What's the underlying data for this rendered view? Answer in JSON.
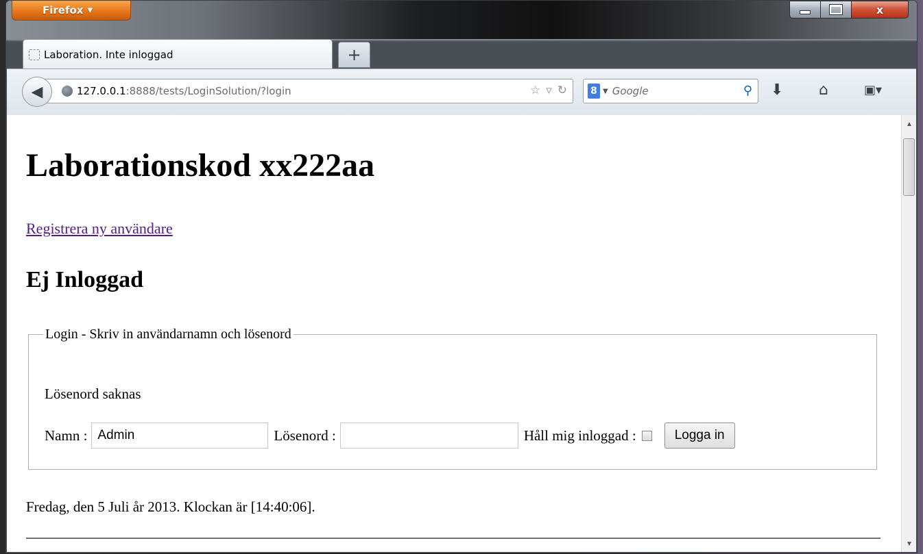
{
  "browser": {
    "menu_button": "Firefox",
    "menu_arrow": "▼",
    "tab_title": "Laboration. Inte inloggad",
    "new_tab": "+",
    "url_host": "127.0.0.1",
    "url_path": ":8888/tests/LoginSolution/?login",
    "search_engine_letter": "8",
    "search_placeholder": "Google",
    "window_controls": {
      "close": "x"
    }
  },
  "page": {
    "title": "Laborationskod xx222aa",
    "register_link": "Registrera ny användare",
    "status_heading": "Ej Inloggad",
    "login": {
      "legend": "Login - Skriv in användarnamn och lösenord",
      "message": "Lösenord saknas",
      "name_label": "Namn :",
      "name_value": "Admin",
      "password_label": "Lösenord :",
      "password_value": "",
      "keep_logged_in_label": "Håll mig inloggad :",
      "keep_logged_in_checked": false,
      "submit": "Logga in"
    },
    "date_line": "Fredag, den 5 Juli år 2013. Klockan är [14:40:06]."
  },
  "colors": {
    "visited_link": "#551a8b",
    "firefox_orange": "#e8761b"
  }
}
